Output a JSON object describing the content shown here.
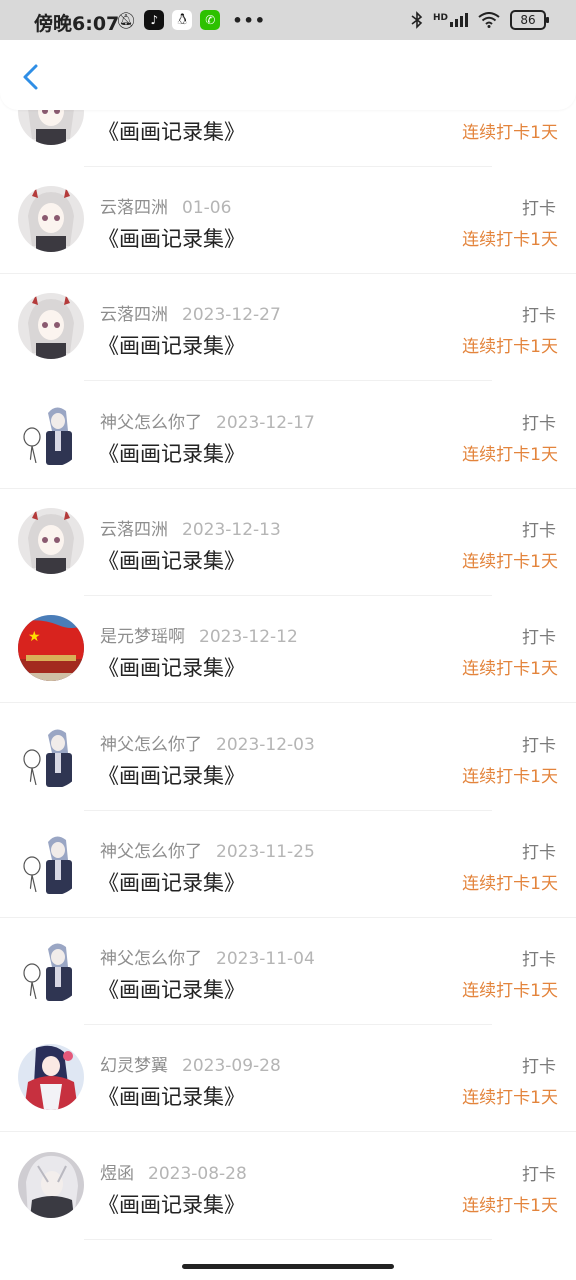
{
  "status_bar": {
    "time": "傍晚6:07",
    "battery": "86",
    "network_label": "HD"
  },
  "header": {
    "back_icon": "chevron-left-icon"
  },
  "items": [
    {
      "name": "",
      "date": "",
      "title": "《画画记录集》",
      "checkin": "",
      "streak": "连续打卡1天",
      "avatar": "anime-girl-white-hair"
    },
    {
      "name": "云落四洲",
      "date": "01-06",
      "title": "《画画记录集》",
      "checkin": "打卡",
      "streak": "连续打卡1天",
      "avatar": "anime-girl-white-hair"
    },
    {
      "name": "云落四洲",
      "date": "2023-12-27",
      "title": "《画画记录集》",
      "checkin": "打卡",
      "streak": "连续打卡1天",
      "avatar": "anime-girl-white-hair"
    },
    {
      "name": "神父怎么你了",
      "date": "2023-12-17",
      "title": "《画画记录集》",
      "checkin": "打卡",
      "streak": "连续打卡1天",
      "avatar": "priest-sketch"
    },
    {
      "name": "云落四洲",
      "date": "2023-12-13",
      "title": "《画画记录集》",
      "checkin": "打卡",
      "streak": "连续打卡1天",
      "avatar": "anime-girl-white-hair"
    },
    {
      "name": "是元梦瑶啊",
      "date": "2023-12-12",
      "title": "《画画记录集》",
      "checkin": "打卡",
      "streak": "连续打卡1天",
      "avatar": "flag-gate"
    },
    {
      "name": "神父怎么你了",
      "date": "2023-12-03",
      "title": "《画画记录集》",
      "checkin": "打卡",
      "streak": "连续打卡1天",
      "avatar": "priest-sketch"
    },
    {
      "name": "神父怎么你了",
      "date": "2023-11-25",
      "title": "《画画记录集》",
      "checkin": "打卡",
      "streak": "连续打卡1天",
      "avatar": "priest-sketch"
    },
    {
      "name": "神父怎么你了",
      "date": "2023-11-04",
      "title": "《画画记录集》",
      "checkin": "打卡",
      "streak": "连续打卡1天",
      "avatar": "priest-sketch"
    },
    {
      "name": "幻灵梦翼",
      "date": "2023-09-28",
      "title": "《画画记录集》",
      "checkin": "打卡",
      "streak": "连续打卡1天",
      "avatar": "anime-girl-kimono"
    },
    {
      "name": "煜函",
      "date": "2023-08-28",
      "title": "《画画记录集》",
      "checkin": "打卡",
      "streak": "连续打卡1天",
      "avatar": "silver-hair-character"
    }
  ],
  "colors": {
    "accent_orange": "#e3843c",
    "back_blue": "#2f8ee6",
    "status_bar_bg": "#d9d9d9"
  }
}
